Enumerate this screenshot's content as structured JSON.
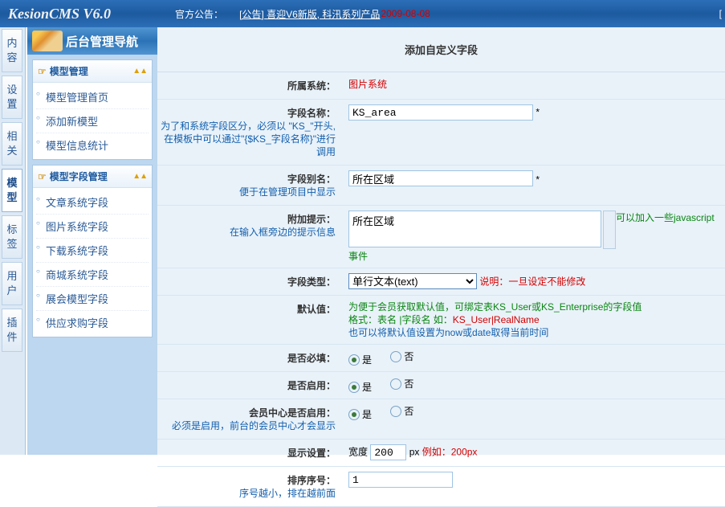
{
  "top": {
    "logo": "KesionCMS V6.0",
    "ann_label": "官方公告：",
    "ann_text": "[公告] 喜迎V6新版, 科汛系列产品",
    "ann_date": "2009-08-08",
    "right_bracket": "["
  },
  "leftTabs": [
    "内容",
    "设置",
    "相关",
    "模型",
    "标签",
    "用户",
    "插件"
  ],
  "activeTabIndex": 3,
  "panelTitle": "后台管理导航",
  "groups": [
    {
      "title": "模型管理",
      "items": [
        "模型管理首页",
        "添加新模型",
        "模型信息统计"
      ]
    },
    {
      "title": "模型字段管理",
      "items": [
        "文章系统字段",
        "图片系统字段",
        "下载系统字段",
        "商城系统字段",
        "展会模型字段",
        "供应求购字段"
      ]
    }
  ],
  "content": {
    "title": "添加自定义字段",
    "systemLabel": "所属系统：",
    "systemValue": "图片系统",
    "fieldNameLabel": "字段名称：",
    "fieldNameHint": "为了和系统字段区分，必须以 \"KS_\"开头,在模板中可以通过\"{$KS_字段名称}\"进行调用",
    "fieldNameValue": "KS_area",
    "aliasLabel": "字段别名：",
    "aliasHint": "便于在管理项目中显示",
    "aliasValue": "所在区域",
    "tipLabel": "附加提示：",
    "tipHint": "在输入框旁边的提示信息",
    "tipValue": "所在区域",
    "tipRight": "可以加入一些javascript事件",
    "typeLabel": "字段类型：",
    "typeValue": "单行文本(text)",
    "typeNote": "说明：一旦设定不能修改",
    "defaultLabel": "默认值：",
    "defaultL1a": "为便于会员获取默认值，可绑定表KS_User或KS_Enterprise的字段值",
    "defaultL2a": "格式：表名 |字段名 如：",
    "defaultL2b": "KS_User|RealName",
    "defaultL3": "也可以将默认值设置为now或date取得当前时间",
    "requiredLabel": "是否必填：",
    "enabledLabel": "是否启用：",
    "memberEnabledLabel": "会员中心是否启用：",
    "memberEnabledHint": "必须是启用，前台的会员中心才会显示",
    "yes": "是",
    "no": "否",
    "displayLabel": "显示设置：",
    "widthLabel": "宽度",
    "widthValue": "200",
    "pxUnit": "px",
    "widthExample": " 例如：200px",
    "orderLabel": "排序序号：",
    "orderHint": "序号越小，排在越前面",
    "orderValue": "1",
    "star": " *"
  }
}
